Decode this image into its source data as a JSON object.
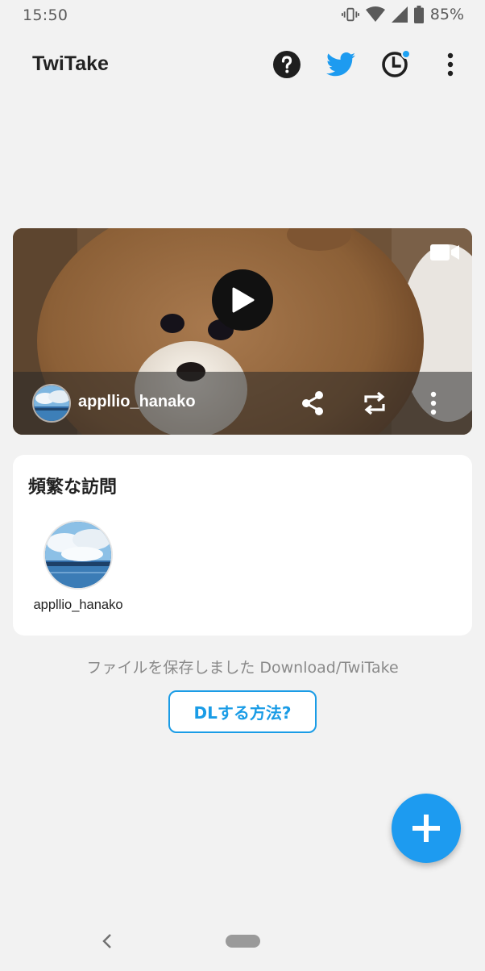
{
  "status_bar": {
    "time": "15:50",
    "battery_percent": "85%",
    "icons": [
      "vibrate-icon",
      "wifi-icon",
      "cell-signal-icon",
      "battery-icon"
    ]
  },
  "app_bar": {
    "title": "TwiTake",
    "icons": [
      "help-icon",
      "twitter-bird-icon",
      "history-clock-icon",
      "more-vert-icon"
    ],
    "history_has_notification": true
  },
  "video_card": {
    "media_type_icon": "videocam-icon",
    "username": "appllio_hanako",
    "actions": [
      "share-icon",
      "retweet-icon",
      "more-vert-icon"
    ]
  },
  "frequent_visits": {
    "title": "頻繁な訪問",
    "items": [
      {
        "name": "appllio_hanako"
      }
    ]
  },
  "saved_message": "ファイルを保存しました Download/TwiTake",
  "howto_button": "DLする方法?",
  "fab_icon": "plus-icon",
  "colors": {
    "accent": "#1d9bf0",
    "background": "#f2f2f2",
    "card": "#ffffff"
  }
}
